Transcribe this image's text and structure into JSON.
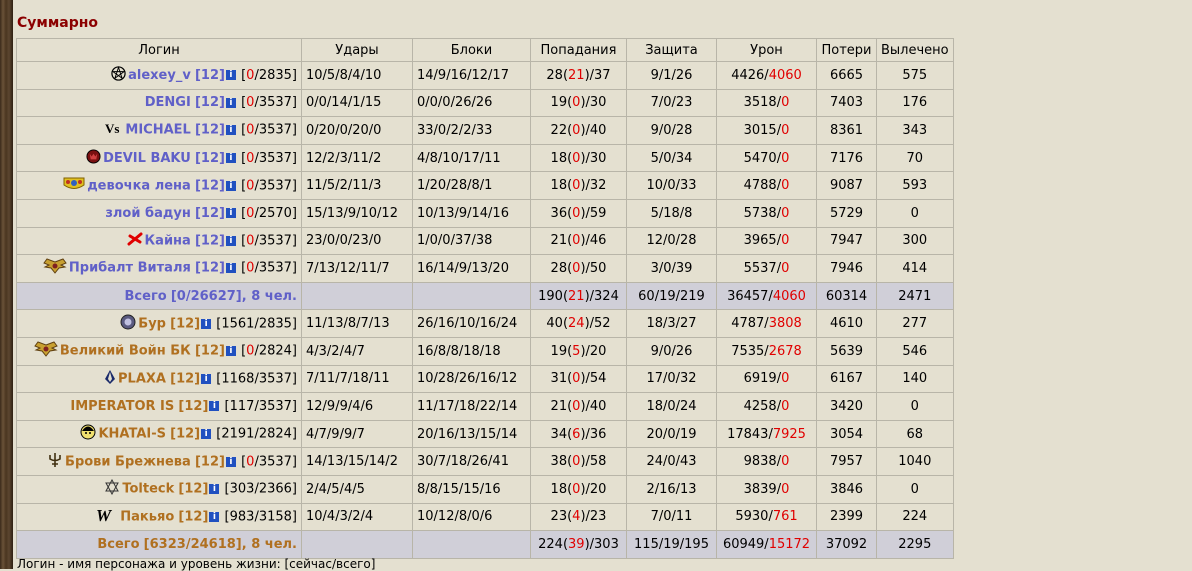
{
  "title": "Суммарно",
  "headers": [
    "Логин",
    "Удары",
    "Блоки",
    "Попадания",
    "Защита",
    "Урон",
    "Потери",
    "Вылечено"
  ],
  "team1": {
    "rows": [
      {
        "icon": "pentagram-icon",
        "name": "alexey_v",
        "lvl": "[12]",
        "hp_cur": "0",
        "hp_max": "2835",
        "hp_red": true,
        "udary": "10/5/8/4/10",
        "bloki": "14/9/16/12/17",
        "pop_a": "28",
        "pop_b": "21",
        "pop_c": "37",
        "pop_red": true,
        "zash": "9/1/26",
        "uron_a": "4426",
        "uron_b": "4060",
        "uron_red": true,
        "poteri": "6665",
        "vyl": "575"
      },
      {
        "icon": "",
        "name": "DENGI",
        "lvl": "[12]",
        "hp_cur": "0",
        "hp_max": "3537",
        "hp_red": true,
        "udary": "0/0/14/1/15",
        "bloki": "0/0/0/26/26",
        "pop_a": "19",
        "pop_b": "0",
        "pop_c": "30",
        "pop_red": true,
        "zash": "7/0/23",
        "uron_a": "3518",
        "uron_b": "0",
        "uron_red": true,
        "poteri": "7403",
        "vyl": "176"
      },
      {
        "icon": "vs-icon",
        "name": "MICHAEL",
        "lvl": "[12]",
        "hp_cur": "0",
        "hp_max": "3537",
        "hp_red": true,
        "udary": "0/20/0/20/0",
        "bloki": "33/0/2/2/33",
        "pop_a": "22",
        "pop_b": "0",
        "pop_c": "40",
        "pop_red": true,
        "zash": "9/0/28",
        "uron_a": "3015",
        "uron_b": "0",
        "uron_red": true,
        "poteri": "8361",
        "vyl": "343"
      },
      {
        "icon": "devil-icon",
        "name": "DEVIL BAKU",
        "lvl": "[12]",
        "hp_cur": "0",
        "hp_max": "3537",
        "hp_red": true,
        "udary": "12/2/3/11/2",
        "bloki": "4/8/10/17/11",
        "pop_a": "18",
        "pop_b": "0",
        "pop_c": "30",
        "pop_red": true,
        "zash": "5/0/34",
        "uron_a": "5470",
        "uron_b": "0",
        "uron_red": true,
        "poteri": "7176",
        "vyl": "70"
      },
      {
        "icon": "crest-icon",
        "name": "девочка лена",
        "lvl": "[12]",
        "hp_cur": "0",
        "hp_max": "3537",
        "hp_red": true,
        "udary": "11/5/2/11/3",
        "bloki": "1/20/28/8/1",
        "pop_a": "18",
        "pop_b": "0",
        "pop_c": "32",
        "pop_red": true,
        "zash": "10/0/33",
        "uron_a": "4788",
        "uron_b": "0",
        "uron_red": true,
        "poteri": "9087",
        "vyl": "593"
      },
      {
        "icon": "",
        "name": "злой бадун",
        "lvl": "[12]",
        "hp_cur": "0",
        "hp_max": "2570",
        "hp_red": true,
        "udary": "15/13/9/10/12",
        "bloki": "10/13/9/14/16",
        "pop_a": "36",
        "pop_b": "0",
        "pop_c": "59",
        "pop_red": true,
        "zash": "5/18/8",
        "uron_a": "5738",
        "uron_b": "0",
        "uron_red": true,
        "poteri": "5729",
        "vyl": "0"
      },
      {
        "icon": "red-cross-icon",
        "name": "Кайна",
        "lvl": "[12]",
        "hp_cur": "0",
        "hp_max": "3537",
        "hp_red": true,
        "udary": "23/0/0/23/0",
        "bloki": "1/0/0/37/38",
        "pop_a": "21",
        "pop_b": "0",
        "pop_c": "46",
        "pop_red": true,
        "zash": "12/0/28",
        "uron_a": "3965",
        "uron_b": "0",
        "uron_red": true,
        "poteri": "7947",
        "vyl": "300"
      },
      {
        "icon": "wings-icon",
        "name": "Прибалт Виталя",
        "lvl": "[12]",
        "hp_cur": "0",
        "hp_max": "3537",
        "hp_red": true,
        "udary": "7/13/12/11/7",
        "bloki": "16/14/9/13/20",
        "pop_a": "28",
        "pop_b": "0",
        "pop_c": "50",
        "pop_red": true,
        "zash": "3/0/39",
        "uron_a": "5537",
        "uron_b": "0",
        "uron_red": true,
        "poteri": "7946",
        "vyl": "414"
      }
    ],
    "total": {
      "label": "Всего",
      "hp_cur": "0",
      "hp_max": "26627",
      "count": ", 8 чел.",
      "pop_a": "190",
      "pop_b": "21",
      "pop_c": "324",
      "zash": "60/19/219",
      "uron_a": "36457",
      "uron_b": "4060",
      "poteri": "60314",
      "vyl": "2471"
    }
  },
  "team2": {
    "rows": [
      {
        "icon": "emblem-icon",
        "name": "Бур",
        "lvl": "[12]",
        "hp_cur": "1561",
        "hp_max": "2835",
        "hp_red": false,
        "udary": "11/13/8/7/13",
        "bloki": "26/16/10/16/24",
        "pop_a": "40",
        "pop_b": "24",
        "pop_c": "52",
        "pop_red": true,
        "zash": "18/3/27",
        "uron_a": "4787",
        "uron_b": "3808",
        "uron_red": true,
        "poteri": "4610",
        "vyl": "277"
      },
      {
        "icon": "wings-icon",
        "name": "Великий Войн БК",
        "lvl": "[12]",
        "hp_cur": "0",
        "hp_max": "2824",
        "hp_red": true,
        "udary": "4/3/2/4/7",
        "bloki": "16/8/8/18/18",
        "pop_a": "19",
        "pop_b": "5",
        "pop_c": "20",
        "pop_red": true,
        "zash": "9/0/26",
        "uron_a": "7535",
        "uron_b": "2678",
        "uron_red": true,
        "poteri": "5639",
        "vyl": "546"
      },
      {
        "icon": "blade-icon",
        "name": "PLAXA",
        "lvl": "[12]",
        "hp_cur": "1168",
        "hp_max": "3537",
        "hp_red": false,
        "udary": "7/11/7/18/11",
        "bloki": "10/28/26/16/12",
        "pop_a": "31",
        "pop_b": "0",
        "pop_c": "54",
        "pop_red": true,
        "zash": "17/0/32",
        "uron_a": "6919",
        "uron_b": "0",
        "uron_red": true,
        "poteri": "6167",
        "vyl": "140"
      },
      {
        "icon": "",
        "name": "IMPERATOR IS",
        "lvl": "[12]",
        "hp_cur": "117",
        "hp_max": "3537",
        "hp_red": false,
        "udary": "12/9/9/4/6",
        "bloki": "11/17/18/22/14",
        "pop_a": "21",
        "pop_b": "0",
        "pop_c": "40",
        "pop_red": true,
        "zash": "18/0/24",
        "uron_a": "4258",
        "uron_b": "0",
        "uron_red": true,
        "poteri": "3420",
        "vyl": "0"
      },
      {
        "icon": "face-icon",
        "name": "KHATAI-S",
        "lvl": "[12]",
        "hp_cur": "2191",
        "hp_max": "2824",
        "hp_red": false,
        "udary": "4/7/9/9/7",
        "bloki": "20/16/13/15/14",
        "pop_a": "34",
        "pop_b": "6",
        "pop_c": "36",
        "pop_red": true,
        "zash": "20/0/19",
        "uron_a": "17843",
        "uron_b": "7925",
        "uron_red": true,
        "poteri": "3054",
        "vyl": "68"
      },
      {
        "icon": "trident-icon",
        "name": "Брови Брежнева",
        "lvl": "[12]",
        "hp_cur": "0",
        "hp_max": "3537",
        "hp_red": true,
        "udary": "14/13/15/14/2",
        "bloki": "30/7/18/26/41",
        "pop_a": "38",
        "pop_b": "0",
        "pop_c": "58",
        "pop_red": true,
        "zash": "24/0/43",
        "uron_a": "9838",
        "uron_b": "0",
        "uron_red": true,
        "poteri": "7957",
        "vyl": "1040"
      },
      {
        "icon": "star-icon",
        "name": "Tolteck",
        "lvl": "[12]",
        "hp_cur": "303",
        "hp_max": "2366",
        "hp_red": false,
        "udary": "2/4/5/4/5",
        "bloki": "8/8/15/15/16",
        "pop_a": "18",
        "pop_b": "0",
        "pop_c": "20",
        "pop_red": true,
        "zash": "2/16/13",
        "uron_a": "3839",
        "uron_b": "0",
        "uron_red": true,
        "poteri": "3846",
        "vyl": "0"
      },
      {
        "icon": "w-letter-icon",
        "name": "Пакьяо",
        "lvl": "[12]",
        "hp_cur": "983",
        "hp_max": "3158",
        "hp_red": false,
        "udary": "10/4/3/2/4",
        "bloki": "10/12/8/0/6",
        "pop_a": "23",
        "pop_b": "4",
        "pop_c": "23",
        "pop_red": true,
        "zash": "7/0/11",
        "uron_a": "5930",
        "uron_b": "761",
        "uron_red": true,
        "poteri": "2399",
        "vyl": "224"
      }
    ],
    "total": {
      "label": "Всего",
      "hp_cur": "6323",
      "hp_max": "24618",
      "count": ", 8 чел.",
      "pop_a": "224",
      "pop_b": "39",
      "pop_c": "303",
      "zash": "115/19/195",
      "uron_a": "60949",
      "uron_b": "15172",
      "poteri": "37092",
      "vyl": "2295"
    }
  },
  "footer": "Логин - имя персонажа и уровень жизни: [сейчас/всего]"
}
